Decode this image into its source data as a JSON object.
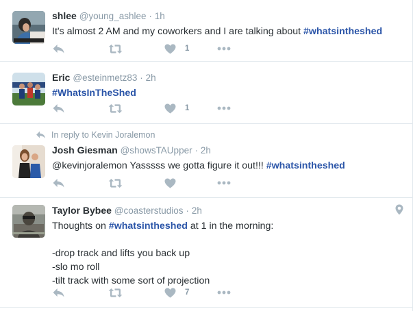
{
  "colors": {
    "hashtag": "#2b55a8",
    "meta": "#8899a6",
    "text": "#292f33",
    "divider": "#e1e8ed"
  },
  "tweets": [
    {
      "name": "shlee",
      "handle": "@young_ashlee",
      "sep": "·",
      "time": "1h",
      "text_prefix": "It's almost 2 AM and my coworkers and I are talking about ",
      "hashtag": "#whatsintheshed",
      "text_suffix": "",
      "like_count": "1",
      "icons": [
        "reply-icon",
        "retweet-icon",
        "heart-icon",
        "more-icon"
      ]
    },
    {
      "name": "Eric",
      "handle": "@esteinmetz83",
      "sep": "·",
      "time": "2h",
      "text_prefix": "",
      "hashtag": "#WhatsInTheShed",
      "text_suffix": "",
      "like_count": "1",
      "icons": [
        "reply-icon",
        "retweet-icon",
        "heart-icon",
        "more-icon"
      ]
    },
    {
      "reply_context": "In reply to Kevin Joralemon",
      "name": "Josh Giesman",
      "handle": "@showsTAUpper",
      "sep": "·",
      "time": "2h",
      "text_prefix": "@kevinjoralemon Yasssss we gotta figure it out!!! ",
      "hashtag": "#whatsintheshed",
      "text_suffix": "",
      "like_count": "",
      "icons": [
        "reply-icon",
        "retweet-icon",
        "heart-icon",
        "more-icon"
      ]
    },
    {
      "name": "Taylor Bybee",
      "handle": "@coasterstudios",
      "sep": "·",
      "time": "2h",
      "text_prefix": "Thoughts on ",
      "hashtag": "#whatsintheshed",
      "text_suffix": " at 1 in the morning:\n\n-drop track and lifts you back up\n-slo mo roll\n-tilt track with some sort of projection",
      "like_count": "7",
      "icons": [
        "reply-icon",
        "retweet-icon",
        "heart-icon",
        "more-icon",
        "location-pin-icon"
      ]
    }
  ]
}
